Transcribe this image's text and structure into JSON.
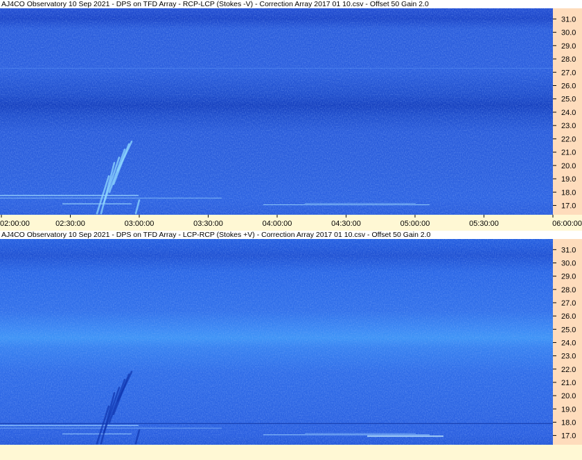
{
  "chart_data": [
    {
      "type": "heatmap",
      "title": "AJ4CO Observatory 10 Sep 2021  -  DPS on TFD Array  -  RCP-LCP (Stokes -V)  -  Correction Array 2017 01 10.csv  -  Offset 50  Gain 2.0",
      "y_ticks": [
        "31.0",
        "30.0",
        "29.0",
        "28.0",
        "27.0",
        "26.0",
        "25.0",
        "24.0",
        "23.0",
        "22.0",
        "21.0",
        "20.0",
        "19.0",
        "18.0",
        "17.0"
      ],
      "y_tick_values": [
        31,
        30,
        29,
        28,
        27,
        26,
        25,
        24,
        23,
        22,
        21,
        20,
        19,
        18,
        17
      ],
      "ylim": [
        16.3,
        31.8
      ],
      "colors": {
        "base": "#2a5bdc",
        "dark_band": "#1845c4",
        "light": "#3f78ee",
        "burst": "#8fd8ff"
      }
    },
    {
      "type": "heatmap",
      "title": "AJ4CO Observatory 10 Sep 2021  -  DPS on TFD Array  -  LCP-RCP (Stokes +V)  -  Correction Array 2017 01 10.csv  -  Offset 50  Gain 2.0",
      "y_ticks": [
        "31.0",
        "30.0",
        "29.0",
        "28.0",
        "27.0",
        "26.0",
        "25.0",
        "24.0",
        "23.0",
        "22.0",
        "21.0",
        "20.0",
        "19.0",
        "18.0",
        "17.0"
      ],
      "y_tick_values": [
        31,
        30,
        29,
        28,
        27,
        26,
        25,
        24,
        23,
        22,
        21,
        20,
        19,
        18,
        17
      ],
      "ylim": [
        16.3,
        31.8
      ],
      "colors": {
        "base": "#2f6be8",
        "light_band": "#3c8ef5",
        "dark": "#1d4fd0",
        "burst": "#1036b0"
      }
    }
  ],
  "x_axis": {
    "ticks": [
      "02:00:00",
      "02:30:00",
      "03:00:00",
      "03:30:00",
      "04:00:00",
      "04:30:00",
      "05:00:00",
      "05:30:00",
      "06:00:00"
    ]
  }
}
